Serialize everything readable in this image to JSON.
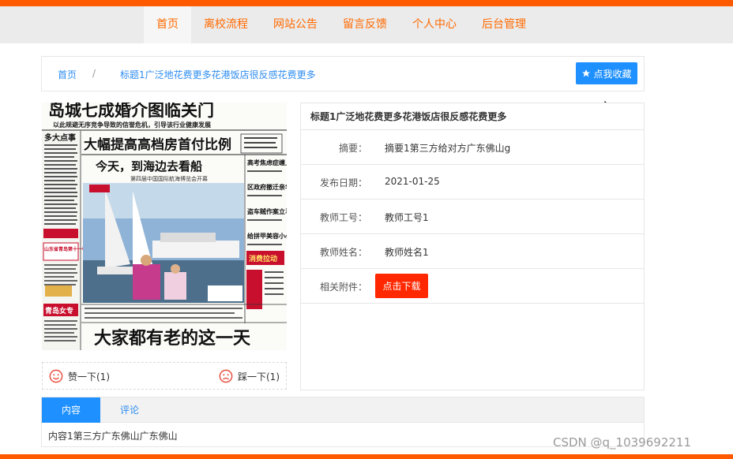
{
  "nav": {
    "items": [
      {
        "label": "首页",
        "active": true
      },
      {
        "label": "离校流程",
        "active": false
      },
      {
        "label": "网站公告",
        "active": false
      },
      {
        "label": "留言反馈",
        "active": false
      },
      {
        "label": "个人中心",
        "active": false
      },
      {
        "label": "后台管理",
        "active": false
      }
    ]
  },
  "breadcrumb": {
    "home": "首页",
    "separator": "/",
    "current": "标题1广泛地花费更多花港饭店很反感花费更多"
  },
  "favorite_button": {
    "label": "点我收藏",
    "icon": "star-icon"
  },
  "newspaper": {
    "headline_top": "岛城七成婚介图临关门",
    "subline": "以此规避无序竞争导致的信誉危机，引导该行业健康发展",
    "box_label": "多大点事",
    "main_headline": "大幅提高高档房首付比例",
    "photo_title": "今天，到海边去看船",
    "photo_subtitle": "第四届中国国际航海博览会开幕",
    "side_items": [
      "高考焦虑症缠上家长",
      "区政府撤迁亲华大楼",
      "盗车贼作案立马落网",
      "给拼甲美容小心毛病"
    ],
    "red_label": "消费拉动",
    "left_block_1": "山东省青岛第十一中学",
    "left_block_2": "青岛女专",
    "bottom_headline": "大家都有老的这一天"
  },
  "likes": {
    "like_label": "赞一下(1)",
    "dislike_label": "踩一下(1)"
  },
  "detail": {
    "title": "标题1广泛地花费更多花港饭店很反感花费更多",
    "rows": [
      {
        "label": "摘要：",
        "value": "摘要1第三方给对方广东佛山g"
      },
      {
        "label": "发布日期：",
        "value": "2021-01-25"
      },
      {
        "label": "教师工号：",
        "value": "教师工号1"
      },
      {
        "label": "教师姓名：",
        "value": "教师姓名1"
      }
    ],
    "attachment_label": "相关附件：",
    "download_label": "点击下载"
  },
  "tabs": {
    "items": [
      {
        "label": "内容",
        "active": true
      },
      {
        "label": "评论",
        "active": false
      }
    ],
    "content": "内容1第三方广东佛山广东佛山"
  },
  "watermark": "CSDN @q_1039692211",
  "colors": {
    "brand_orange": "#ff5a00",
    "accent_blue": "#1e90ff",
    "download_red": "#ff2800"
  }
}
